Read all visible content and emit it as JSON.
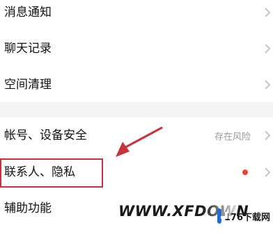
{
  "settings": {
    "items": [
      {
        "label": "消息通知"
      },
      {
        "label": "聊天记录"
      },
      {
        "label": "空间清理"
      },
      {
        "label": "帐号、设备安全",
        "status": "存在风险"
      },
      {
        "label": "联系人、隐私",
        "has_red_dot": true
      },
      {
        "label": "辅助功能"
      }
    ]
  },
  "watermark": {
    "text": "WWW.XFDOWN",
    "logo_text": "176下载网"
  },
  "colors": {
    "highlight_box": "#c8323c",
    "arrow": "#c8323c",
    "red_dot": "#e8432c",
    "logo_blue": "#1f6fd1"
  }
}
